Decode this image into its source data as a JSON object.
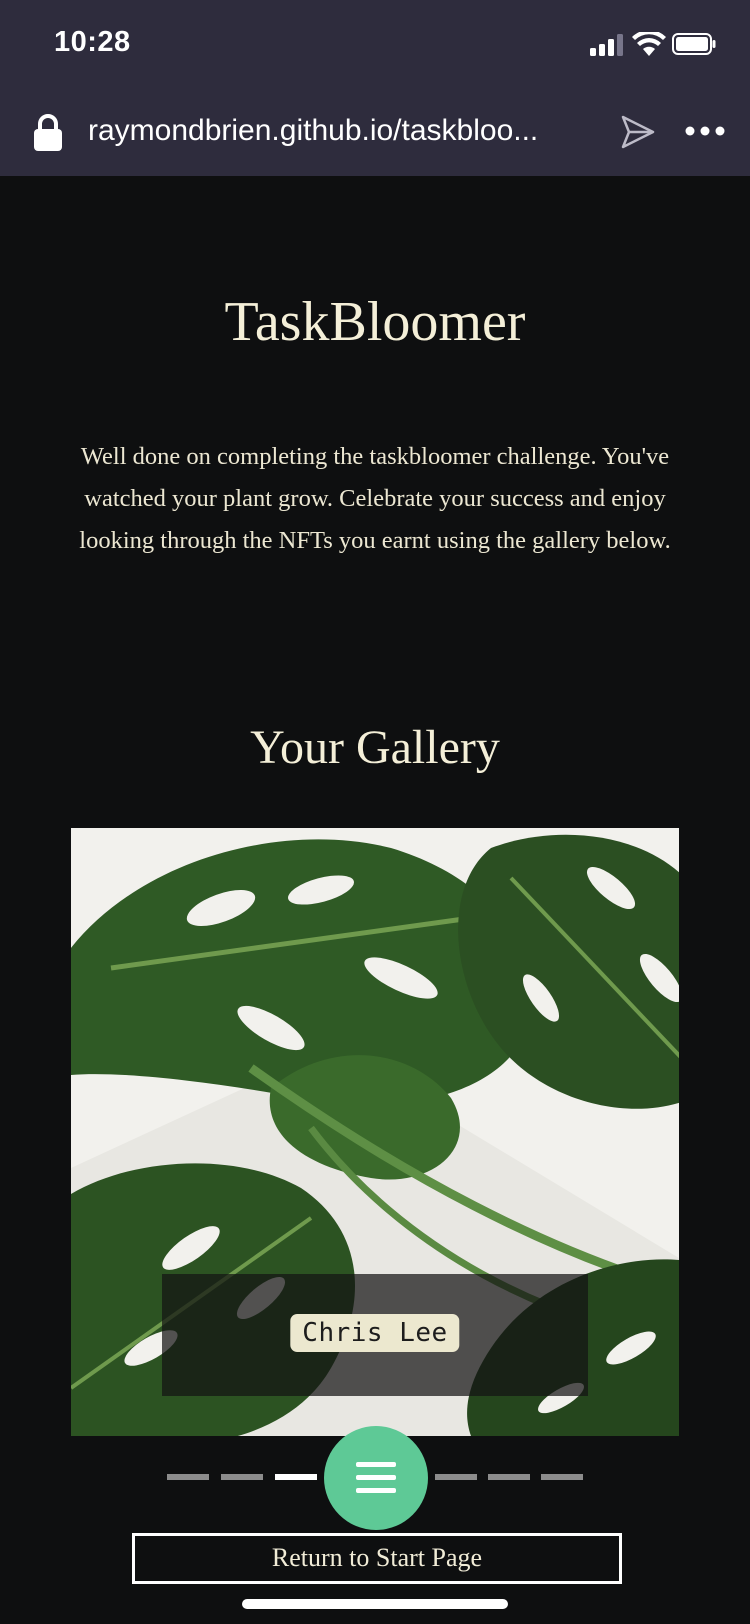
{
  "status_bar": {
    "time": "10:28"
  },
  "browser": {
    "url": "raymondbrien.github.io/taskbloo..."
  },
  "page": {
    "title": "TaskBloomer",
    "intro": "Well done on completing the taskbloomer challenge. You've watched your plant grow. Celebrate your success and enjoy looking through the NFTs you earnt using the gallery below.",
    "gallery_title": "Your Gallery",
    "gallery": {
      "current_caption": "Chris Lee",
      "slide_count": 7,
      "active_slide": 3
    },
    "return_button": "Return to Start Page"
  },
  "colors": {
    "background": "#0e0f10",
    "browser_chrome": "#2e2c3d",
    "accent": "#5ec996",
    "text": "#f1ecd7"
  },
  "icons": [
    "lock-icon",
    "share-icon",
    "more-icon",
    "signal-icon",
    "wifi-icon",
    "battery-icon",
    "menu-icon"
  ]
}
